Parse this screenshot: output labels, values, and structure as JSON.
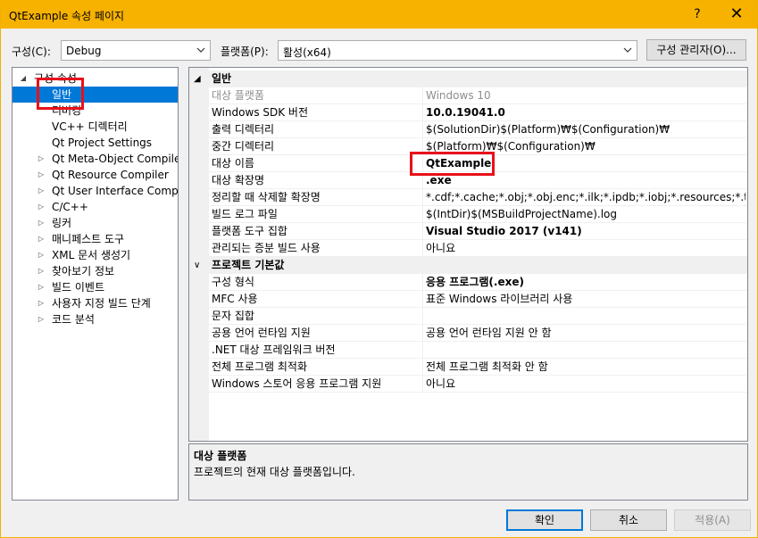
{
  "window": {
    "title": "QtExample 속성 페이지",
    "help": "?",
    "close": "✕"
  },
  "toolbar": {
    "config_label": "구성(C):",
    "config_value": "Debug",
    "platform_label": "플랫폼(P):",
    "platform_value": "활성(x64)",
    "config_manager": "구성 관리자(O)..."
  },
  "tree": {
    "items": [
      {
        "label": "구성 속성",
        "expander": "◢"
      },
      {
        "label": "일반",
        "expander": ""
      },
      {
        "label": "디버깅",
        "expander": ""
      },
      {
        "label": "VC++ 디렉터리",
        "expander": ""
      },
      {
        "label": "Qt Project Settings",
        "expander": ""
      },
      {
        "label": "Qt Meta-Object Compiler",
        "expander": "▷"
      },
      {
        "label": "Qt Resource Compiler",
        "expander": "▷"
      },
      {
        "label": "Qt User Interface Compiler",
        "expander": "▷"
      },
      {
        "label": "C/C++",
        "expander": "▷"
      },
      {
        "label": "링커",
        "expander": "▷"
      },
      {
        "label": "매니페스트 도구",
        "expander": "▷"
      },
      {
        "label": "XML 문서 생성기",
        "expander": "▷"
      },
      {
        "label": "찾아보기 정보",
        "expander": "▷"
      },
      {
        "label": "빌드 이벤트",
        "expander": "▷"
      },
      {
        "label": "사용자 지정 빌드 단계",
        "expander": "▷"
      },
      {
        "label": "코드 분석",
        "expander": "▷"
      }
    ]
  },
  "grid": {
    "general": {
      "title": "일반",
      "chevron": "◢",
      "rows": [
        {
          "name": "대상 플랫폼",
          "value": "Windows 10"
        },
        {
          "name": "Windows SDK 버전",
          "value": "10.0.19041.0"
        },
        {
          "name": "출력 디렉터리",
          "value": "$(SolutionDir)$(Platform)₩$(Configuration)₩"
        },
        {
          "name": "중간 디렉터리",
          "value": "$(Platform)₩$(Configuration)₩"
        },
        {
          "name": "대상 이름",
          "value": "QtExample"
        },
        {
          "name": "대상 확장명",
          "value": ".exe"
        },
        {
          "name": "정리할 때 삭제할 확장명",
          "value": "*.cdf;*.cache;*.obj;*.obj.enc;*.ilk;*.ipdb;*.iobj;*.resources;*.tlb;*.tli;*.tl"
        },
        {
          "name": "빌드 로그 파일",
          "value": "$(IntDir)$(MSBuildProjectName).log"
        },
        {
          "name": "플랫폼 도구 집합",
          "value": "Visual Studio 2017 (v141)"
        },
        {
          "name": "관리되는 증분 빌드 사용",
          "value": "아니요"
        }
      ]
    },
    "defaults": {
      "title": "프로젝트 기본값",
      "chevron": "∨",
      "rows": [
        {
          "name": "구성 형식",
          "value": "응용 프로그램(.exe)"
        },
        {
          "name": "MFC 사용",
          "value": "표준 Windows 라이브러리 사용"
        },
        {
          "name": "문자 집합",
          "value": ""
        },
        {
          "name": "공용 언어 런타임 지원",
          "value": "공용 언어 런타임 지원 안 함"
        },
        {
          "name": ".NET 대상 프레임워크 버전",
          "value": ""
        },
        {
          "name": "전체 프로그램 최적화",
          "value": "전체 프로그램 최적화 안 함"
        },
        {
          "name": "Windows 스토어 응용 프로그램 지원",
          "value": "아니요"
        }
      ]
    }
  },
  "description": {
    "title": "대상 플랫폼",
    "text": "프로젝트의 현재 대상 플랫폼입니다."
  },
  "buttons": {
    "ok": "확인",
    "cancel": "취소",
    "apply": "적용(A)"
  },
  "colors": {
    "titlebar": "#f7b200",
    "selection": "#0078d7",
    "annotation": "#e8101b"
  }
}
